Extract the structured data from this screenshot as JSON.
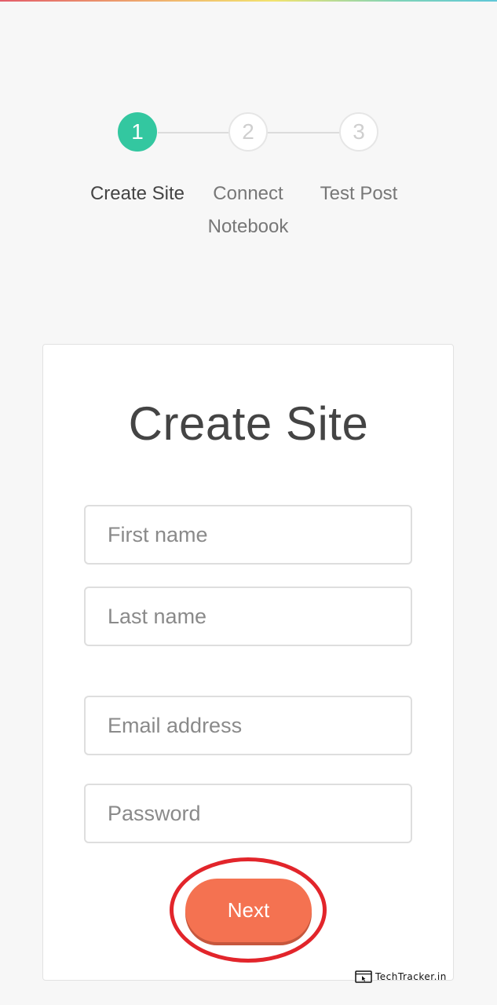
{
  "stepper": {
    "steps": [
      {
        "number": "1",
        "label": "Create Site",
        "state": "active"
      },
      {
        "number": "2",
        "label_line1": "Connect",
        "label_line2": "Notebook",
        "state": "inactive"
      },
      {
        "number": "3",
        "label": "Test Post",
        "state": "inactive"
      }
    ],
    "active_color": "#33c7a0"
  },
  "form": {
    "title": "Create Site",
    "first_name_placeholder": "First name",
    "last_name_placeholder": "Last name",
    "email_placeholder": "Email address",
    "password_placeholder": "Password",
    "next_label": "Next",
    "next_color": "#f47251",
    "highlight_color": "#e2252b"
  },
  "watermark": {
    "text": "TechTracker.in",
    "icon": "browser-cursor-icon"
  }
}
